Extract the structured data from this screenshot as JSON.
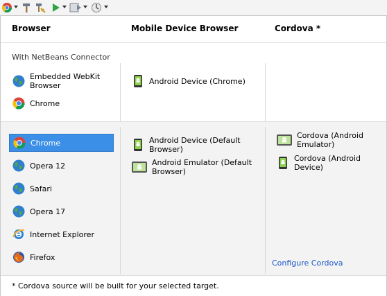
{
  "columns": {
    "browser": "Browser",
    "mobile": "Mobile Device Browser",
    "cordova": "Cordova *"
  },
  "connector_label": "With NetBeans Connector",
  "connector_items": [
    {
      "label": "Embedded WebKit Browser",
      "icon": "globe-icon"
    },
    {
      "label": "Chrome",
      "icon": "chrome-icon"
    }
  ],
  "connector_mobile_items": [
    {
      "label": "Android Device (Chrome)",
      "icon": "android-device-icon"
    }
  ],
  "browser_items": [
    {
      "label": "Chrome",
      "icon": "chrome-icon",
      "selected": true
    },
    {
      "label": "Opera 12",
      "icon": "globe-icon"
    },
    {
      "label": "Safari",
      "icon": "globe-icon"
    },
    {
      "label": "Opera 17",
      "icon": "globe-icon"
    },
    {
      "label": "Internet Explorer",
      "icon": "internet-explorer-icon"
    },
    {
      "label": "Firefox",
      "icon": "firefox-icon"
    }
  ],
  "mobile_items": [
    {
      "label": "Android Device (Default Browser)",
      "icon": "android-device-icon"
    },
    {
      "label": "Android Emulator (Default Browser)",
      "icon": "android-emulator-icon"
    }
  ],
  "cordova_items": [
    {
      "label": "Cordova (Android Emulator)",
      "icon": "android-emulator-icon"
    },
    {
      "label": "Cordova (Android Device)",
      "icon": "android-device-icon"
    }
  ],
  "configure_link": "Configure Cordova",
  "footnote": "* Cordova source will be built for your selected target.",
  "colors": {
    "selection": "#3b8fe6",
    "link": "#1a56c8"
  }
}
